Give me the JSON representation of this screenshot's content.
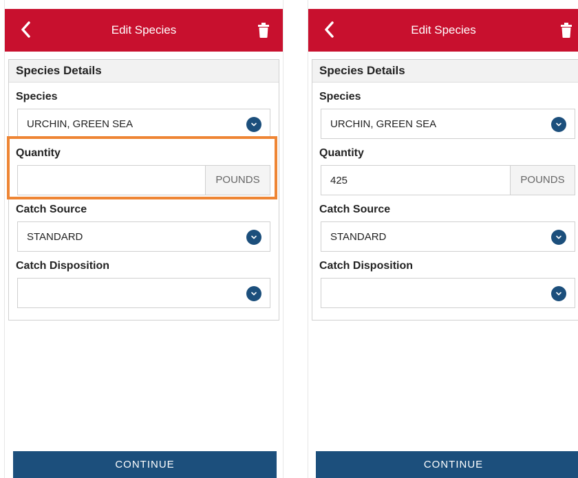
{
  "screens": [
    {
      "header": {
        "title": "Edit Species"
      },
      "card": {
        "heading": "Species Details",
        "species": {
          "label": "Species",
          "value": "URCHIN, GREEN SEA"
        },
        "quantity": {
          "label": "Quantity",
          "value": "",
          "unit": "POUNDS"
        },
        "catch_source": {
          "label": "Catch Source",
          "value": "STANDARD"
        },
        "catch_disposition": {
          "label": "Catch Disposition",
          "value": ""
        }
      },
      "continue_label": "CONTINUE"
    },
    {
      "header": {
        "title": "Edit Species"
      },
      "card": {
        "heading": "Species Details",
        "species": {
          "label": "Species",
          "value": "URCHIN, GREEN SEA"
        },
        "quantity": {
          "label": "Quantity",
          "value": "425",
          "unit": "POUNDS"
        },
        "catch_source": {
          "label": "Catch Source",
          "value": "STANDARD"
        },
        "catch_disposition": {
          "label": "Catch Disposition",
          "value": ""
        }
      },
      "continue_label": "CONTINUE"
    }
  ],
  "colors": {
    "header_red": "#c8102e",
    "primary_blue": "#1c4f7c",
    "highlight_orange": "#ee8534"
  },
  "icons": [
    "back-arrow-icon",
    "trash-icon",
    "chevron-down-icon"
  ]
}
